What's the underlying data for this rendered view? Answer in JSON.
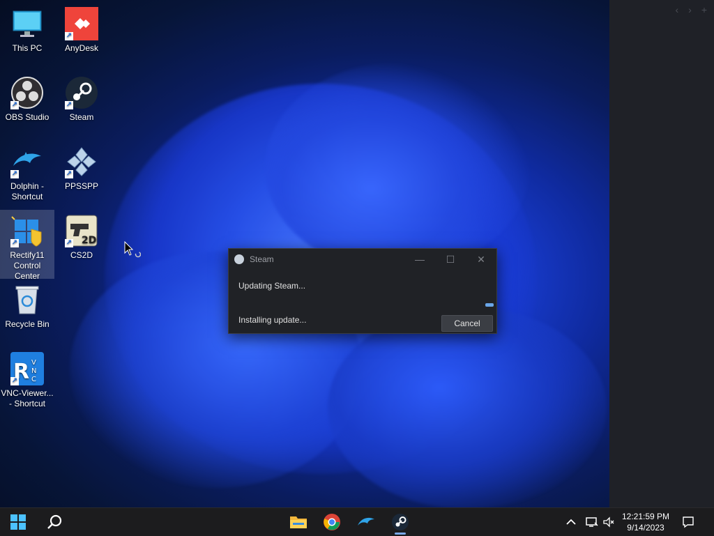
{
  "desktop": {
    "icons": [
      {
        "label": "This PC"
      },
      {
        "label": "AnyDesk"
      },
      {
        "label": "OBS Studio"
      },
      {
        "label": "Steam"
      },
      {
        "label": "Dolphin - Shortcut"
      },
      {
        "label": "PPSSPP"
      },
      {
        "label": "Rectify11 Control Center"
      },
      {
        "label": "CS2D"
      },
      {
        "label": "Recycle Bin"
      },
      {
        "label": "VNC-Viewer... - Shortcut"
      }
    ]
  },
  "dialog": {
    "title": "Steam",
    "status": "Updating Steam...",
    "detail": "Installing update...",
    "cancel_label": "Cancel",
    "minimize_glyph": "—",
    "maximize_glyph": "☐",
    "close_glyph": "✕"
  },
  "side_panel": {
    "back_glyph": "‹",
    "forward_glyph": "›",
    "add_glyph": "+"
  },
  "taskbar": {
    "time": "12:21:59 PM",
    "date": "9/14/2023"
  },
  "colors": {
    "accent": "#6aa6e8",
    "dialog_bg": "#202226",
    "taskbar_bg": "#1c1c1e"
  }
}
